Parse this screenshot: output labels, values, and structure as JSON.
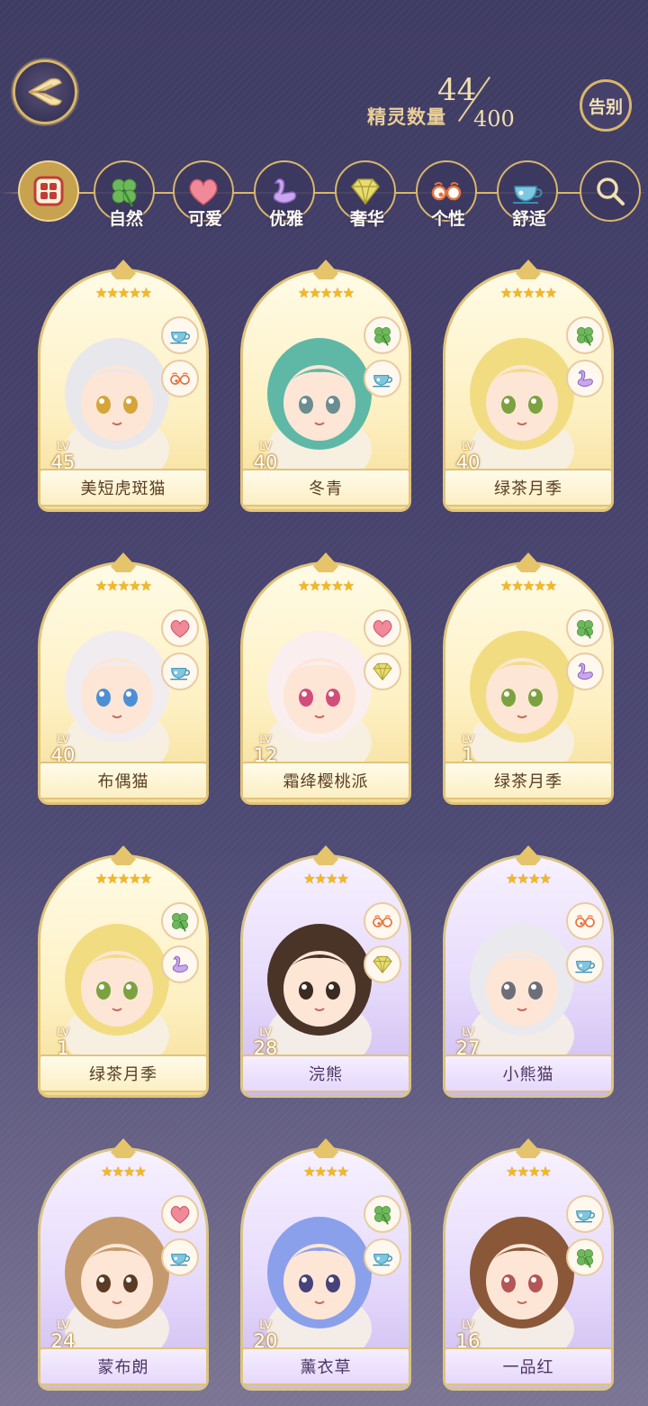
{
  "header": {
    "back_label": "返回",
    "count_label": "精灵数量",
    "count_now": "44",
    "count_total": "400",
    "farewell_label": "告别"
  },
  "filters": [
    {
      "label": "",
      "icon": "all-grid-icon",
      "active": true
    },
    {
      "label": "自然",
      "icon": "clover-icon",
      "active": false
    },
    {
      "label": "可爱",
      "icon": "heart-icon",
      "active": false
    },
    {
      "label": "优雅",
      "icon": "swan-icon",
      "active": false
    },
    {
      "label": "奢华",
      "icon": "diamond-icon",
      "active": false
    },
    {
      "label": "个性",
      "icon": "glasses-icon",
      "active": false
    },
    {
      "label": "舒适",
      "icon": "teacup-icon",
      "active": false
    },
    {
      "label": "",
      "icon": "search-icon",
      "active": false
    }
  ],
  "cards": [
    {
      "name": "美短虎斑猫",
      "lv_tag": "LV",
      "level": "45",
      "stars": "★★★★★",
      "frame": "gold",
      "traits": [
        "teacup-icon",
        "glasses-icon"
      ]
    },
    {
      "name": "冬青",
      "lv_tag": "LV",
      "level": "40",
      "stars": "★★★★★",
      "frame": "gold",
      "traits": [
        "clover-icon",
        "teacup-icon"
      ]
    },
    {
      "name": "绿茶月季",
      "lv_tag": "LV",
      "level": "40",
      "stars": "★★★★★",
      "frame": "gold",
      "traits": [
        "clover-icon",
        "swan-icon"
      ]
    },
    {
      "name": "布偶猫",
      "lv_tag": "LV",
      "level": "40",
      "stars": "★★★★★",
      "frame": "gold",
      "traits": [
        "heart-icon",
        "teacup-icon"
      ]
    },
    {
      "name": "霜绛樱桃派",
      "lv_tag": "LV",
      "level": "12",
      "stars": "★★★★★",
      "frame": "gold",
      "traits": [
        "heart-icon",
        "diamond-icon"
      ]
    },
    {
      "name": "绿茶月季",
      "lv_tag": "LV",
      "level": "1",
      "stars": "★★★★★",
      "frame": "gold",
      "traits": [
        "clover-icon",
        "swan-icon"
      ]
    },
    {
      "name": "绿茶月季",
      "lv_tag": "LV",
      "level": "1",
      "stars": "★★★★★",
      "frame": "gold",
      "traits": [
        "clover-icon",
        "swan-icon"
      ]
    },
    {
      "name": "浣熊",
      "lv_tag": "LV",
      "level": "28",
      "stars": "★★★★",
      "frame": "purple",
      "traits": [
        "glasses-icon",
        "diamond-icon"
      ]
    },
    {
      "name": "小熊猫",
      "lv_tag": "LV",
      "level": "27",
      "stars": "★★★★",
      "frame": "purple",
      "traits": [
        "glasses-icon",
        "teacup-icon"
      ]
    },
    {
      "name": "蒙布朗",
      "lv_tag": "LV",
      "level": "24",
      "stars": "★★★★",
      "frame": "purple",
      "traits": [
        "heart-icon",
        "teacup-icon"
      ]
    },
    {
      "name": "薰衣草",
      "lv_tag": "LV",
      "level": "20",
      "stars": "★★★★",
      "frame": "purple",
      "traits": [
        "clover-icon",
        "teacup-icon"
      ]
    },
    {
      "name": "一品红",
      "lv_tag": "LV",
      "level": "16",
      "stars": "★★★★",
      "frame": "purple",
      "traits": [
        "teacup-icon",
        "clover-icon"
      ]
    }
  ],
  "colors": {
    "gold": "#d9b76a",
    "background": "#45416b",
    "star": "#f6b81c"
  }
}
